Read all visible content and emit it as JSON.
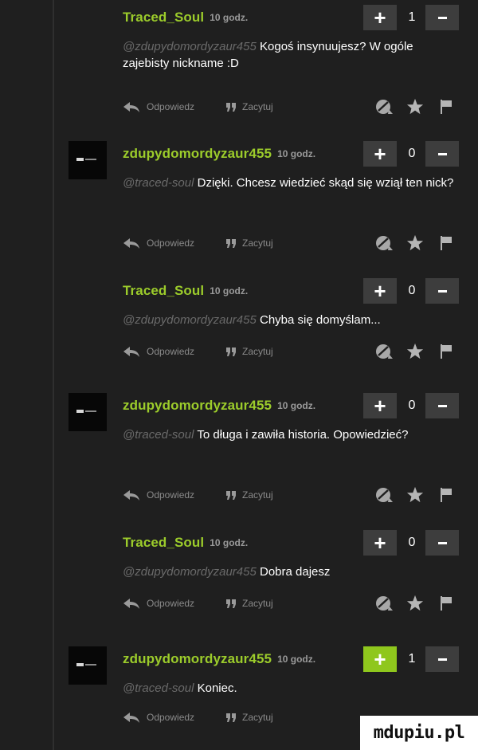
{
  "actions": {
    "reply_label": "Odpowiedz",
    "quote_label": "Zacytuj"
  },
  "colors": {
    "author": "#9ccc2b",
    "upvote_active": "#8fc71d",
    "vote_button": "#3d3d3d",
    "background": "#1f1f1f"
  },
  "icons": [
    "reply-arrow-icon",
    "quote-icon",
    "report-icon",
    "star-icon",
    "flag-icon",
    "plus-icon",
    "minus-icon"
  ],
  "comments": [
    {
      "author": "Traced_Soul",
      "time": "10 godz.",
      "plus": "+",
      "votes": "1",
      "mention": "@zdupydomordyzaur455",
      "text": "Kogoś insynuujesz? W ogóle zajebisty nickname :D"
    },
    {
      "author": "zdupydomordyzaur455",
      "time": "10 godz.",
      "plus": "+",
      "votes": "0",
      "mention": "@traced-soul",
      "text": "Dzięki. Chcesz wiedzieć skąd się wziął ten nick?"
    },
    {
      "author": "Traced_Soul",
      "time": "10 godz.",
      "plus": "+",
      "votes": "0",
      "mention": "@zdupydomordyzaur455",
      "text": "Chyba się domyślam..."
    },
    {
      "author": "zdupydomordyzaur455",
      "time": "10 godz.",
      "plus": "+",
      "votes": "0",
      "mention": "@traced-soul",
      "text": "To długa i zawiła historia. Opowiedzieć?"
    },
    {
      "author": "Traced_Soul",
      "time": "10 godz.",
      "plus": "+",
      "votes": "0",
      "mention": "@zdupydomordyzaur455",
      "text": "Dobra dajesz"
    },
    {
      "author": "zdupydomordyzaur455",
      "time": "10 godz.",
      "plus": "+",
      "votes": "1",
      "mention": "@traced-soul",
      "text": "Koniec."
    }
  ],
  "watermark": "mdupiu.pl"
}
